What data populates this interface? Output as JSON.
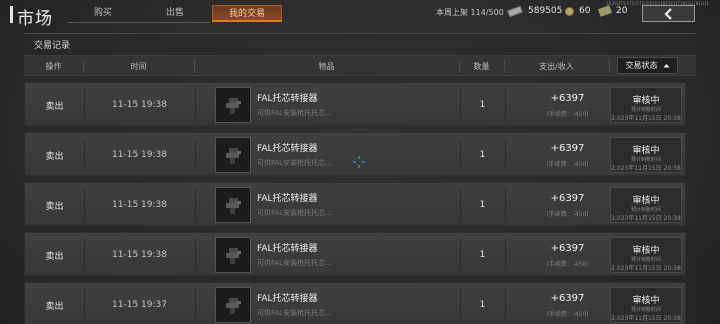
{
  "header": {
    "title": "市场",
    "tabs": [
      {
        "label": "购买"
      },
      {
        "label": "出售"
      },
      {
        "label": "我的交易"
      }
    ],
    "weekly_label": "本周上架",
    "weekly_value": "114/500",
    "currency_cash": "589505",
    "currency_coin": "60",
    "currency_ticket": "20",
    "tiny_code": "1/L1G1T1/1T1/I1T1(1I1/I1)(1B1S)(I1T1R1I1(1B1(1I1"
  },
  "section": {
    "title": "交易记录"
  },
  "table": {
    "columns": {
      "action": "操作",
      "time": "时间",
      "item": "物品",
      "qty": "数量",
      "amount": "支出/收入"
    },
    "status_filter": "交易状态",
    "rows": [
      {
        "action": "卖出",
        "time": "11-15 19:38",
        "name": "FAL托芯转接器",
        "desc": "可供FAL安装枪托托芯...",
        "qty": "1",
        "amount": "+6397",
        "fee": "(手续费：-450)",
        "status": "审核中",
        "status_sub": "预计到账时间",
        "status_date": "2,023年11月15日 20:38"
      },
      {
        "action": "卖出",
        "time": "11-15 19:38",
        "name": "FAL托芯转接器",
        "desc": "可供FAL安装枪托托芯...",
        "qty": "1",
        "amount": "+6397",
        "fee": "(手续费：-450)",
        "status": "审核中",
        "status_sub": "预计到账时间",
        "status_date": "2,023年11月15日 20:38"
      },
      {
        "action": "卖出",
        "time": "11-15 19:38",
        "name": "FAL托芯转接器",
        "desc": "可供FAL安装枪托托芯...",
        "qty": "1",
        "amount": "+6397",
        "fee": "(手续费：-450)",
        "status": "审核中",
        "status_sub": "预计到账时间",
        "status_date": "2,023年11月15日 20:38"
      },
      {
        "action": "卖出",
        "time": "11-15 19:38",
        "name": "FAL托芯转接器",
        "desc": "可供FAL安装枪托托芯...",
        "qty": "1",
        "amount": "+6397",
        "fee": "(手续费：-450)",
        "status": "审核中",
        "status_sub": "预计到账时间",
        "status_date": "2,023年11月15日 20:38"
      },
      {
        "action": "卖出",
        "time": "11-15 19:37",
        "name": "FAL托芯转接器",
        "desc": "可供FAL安装枪托托芯...",
        "qty": "1",
        "amount": "+6397",
        "fee": "(手续费：-450)",
        "status": "审核中",
        "status_sub": "预计到账时间",
        "status_date": "2,023年11月15日 20:38"
      }
    ]
  },
  "icons": {
    "back": "back-arrow-icon",
    "cash": "cash-icon",
    "coin": "coin-icon",
    "ticket": "ticket-icon",
    "item": "stock-adapter-icon",
    "sort": "chevron-up-icon"
  },
  "colors": {
    "accent": "#e07a2a",
    "active_tab_text": "#ffcf9e"
  }
}
